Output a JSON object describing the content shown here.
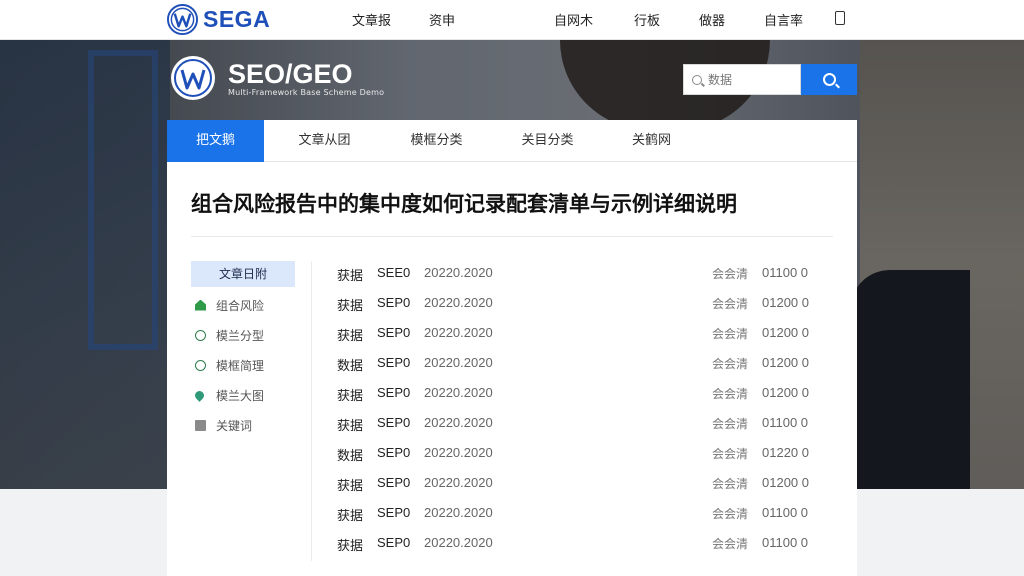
{
  "topbar": {
    "brand": "SEGA",
    "nav": [
      "文章报",
      "资申",
      "自网木",
      "行板",
      "做器",
      "自言率"
    ]
  },
  "hero": {
    "title": "SEO/GEO",
    "subtitle": "Multi-Framework Base Scheme Demo"
  },
  "search": {
    "placeholder": "数据"
  },
  "tabs": [
    "把文鹅",
    "文章从团",
    "模框分类",
    "关目分类",
    "关鹤网"
  ],
  "article": {
    "title": "组合风险报告中的集中度如何记录配套清单与示例详细说明"
  },
  "sidebar": {
    "heading": "文章日附",
    "items": [
      {
        "label": "组合风险",
        "icon": "house-icon"
      },
      {
        "label": "模兰分型",
        "icon": "circle-icon"
      },
      {
        "label": "模框简理",
        "icon": "circle-icon"
      },
      {
        "label": "模兰大图",
        "icon": "pin-icon"
      },
      {
        "label": "关键词",
        "icon": "document-icon"
      }
    ]
  },
  "rows": [
    {
      "c1": "获据",
      "c2": "SEE0",
      "c3": "20220.2020",
      "c4": "会会清",
      "c5": "01100 0"
    },
    {
      "c1": "获据",
      "c2": "SEP0",
      "c3": "20220.2020",
      "c4": "会会清",
      "c5": "01200 0"
    },
    {
      "c1": "获据",
      "c2": "SEP0",
      "c3": "20220.2020",
      "c4": "会会清",
      "c5": "01200 0"
    },
    {
      "c1": "数据",
      "c2": "SEP0",
      "c3": "20220.2020",
      "c4": "会会清",
      "c5": "01200 0"
    },
    {
      "c1": "获据",
      "c2": "SEP0",
      "c3": "20220.2020",
      "c4": "会会清",
      "c5": "01200 0"
    },
    {
      "c1": "获据",
      "c2": "SEP0",
      "c3": "20220.2020",
      "c4": "会会清",
      "c5": "01100 0"
    },
    {
      "c1": "数据",
      "c2": "SEP0",
      "c3": "20220.2020",
      "c4": "会会清",
      "c5": "01220 0"
    },
    {
      "c1": "获据",
      "c2": "SEP0",
      "c3": "20220.2020",
      "c4": "会会清",
      "c5": "01200 0"
    },
    {
      "c1": "获据",
      "c2": "SEP0",
      "c3": "20220.2020",
      "c4": "会会清",
      "c5": "01100 0"
    },
    {
      "c1": "获据",
      "c2": "SEP0",
      "c3": "20220.2020",
      "c4": "会会清",
      "c5": "01100 0"
    }
  ],
  "colors": {
    "accent": "#1a73e8",
    "brand": "#1f4fb8",
    "sidebar_active_bg": "#dbe7fb"
  }
}
